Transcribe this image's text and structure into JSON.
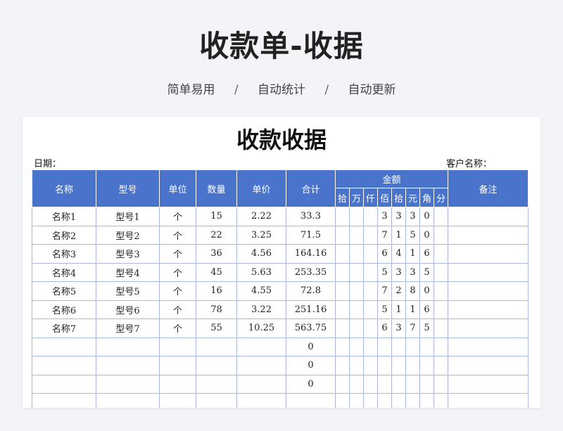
{
  "banner": {
    "title": "收款单-收据",
    "tags": [
      "简单易用",
      "自动统计",
      "自动更新"
    ],
    "separator": "/"
  },
  "sheet": {
    "title": "收款收据",
    "date_label": "日期：",
    "client_label": "客户名称："
  },
  "table": {
    "headers": {
      "name": "名称",
      "model": "型号",
      "unit": "单位",
      "qty": "数量",
      "price": "单价",
      "total": "合计",
      "amount": "金额",
      "remark": "备注"
    },
    "digit_headers": [
      "拾",
      "万",
      "仟",
      "佰",
      "拾",
      "元",
      "角",
      "分"
    ],
    "rows": [
      {
        "name": "名称1",
        "model": "型号1",
        "unit": "个",
        "qty": "15",
        "price": "2.22",
        "total": "33.3",
        "digits": [
          "",
          "",
          "",
          "3",
          "3",
          "3",
          "0",
          ""
        ],
        "remark": ""
      },
      {
        "name": "名称2",
        "model": "型号2",
        "unit": "个",
        "qty": "22",
        "price": "3.25",
        "total": "71.5",
        "digits": [
          "",
          "",
          "",
          "7",
          "1",
          "5",
          "0",
          ""
        ],
        "remark": ""
      },
      {
        "name": "名称3",
        "model": "型号3",
        "unit": "个",
        "qty": "36",
        "price": "4.56",
        "total": "164.16",
        "digits": [
          "",
          "",
          "",
          "6",
          "4",
          "1",
          "6",
          ""
        ],
        "remark": ""
      },
      {
        "name": "名称4",
        "model": "型号4",
        "unit": "个",
        "qty": "45",
        "price": "5.63",
        "total": "253.35",
        "digits": [
          "",
          "",
          "",
          "5",
          "3",
          "3",
          "5",
          ""
        ],
        "remark": ""
      },
      {
        "name": "名称5",
        "model": "型号5",
        "unit": "个",
        "qty": "16",
        "price": "4.55",
        "total": "72.8",
        "digits": [
          "",
          "",
          "",
          "7",
          "2",
          "8",
          "0",
          ""
        ],
        "remark": ""
      },
      {
        "name": "名称6",
        "model": "型号6",
        "unit": "个",
        "qty": "78",
        "price": "3.22",
        "total": "251.16",
        "digits": [
          "",
          "",
          "",
          "5",
          "1",
          "1",
          "6",
          ""
        ],
        "remark": ""
      },
      {
        "name": "名称7",
        "model": "型号7",
        "unit": "个",
        "qty": "55",
        "price": "10.25",
        "total": "563.75",
        "digits": [
          "",
          "",
          "",
          "6",
          "3",
          "7",
          "5",
          ""
        ],
        "remark": ""
      },
      {
        "name": "",
        "model": "",
        "unit": "",
        "qty": "",
        "price": "",
        "total": "0",
        "digits": [
          "",
          "",
          "",
          "",
          "",
          "",
          "",
          ""
        ],
        "remark": ""
      },
      {
        "name": "",
        "model": "",
        "unit": "",
        "qty": "",
        "price": "",
        "total": "0",
        "digits": [
          "",
          "",
          "",
          "",
          "",
          "",
          "",
          ""
        ],
        "remark": ""
      },
      {
        "name": "",
        "model": "",
        "unit": "",
        "qty": "",
        "price": "",
        "total": "0",
        "digits": [
          "",
          "",
          "",
          "",
          "",
          "",
          "",
          ""
        ],
        "remark": ""
      },
      {
        "name": "",
        "model": "",
        "unit": "",
        "qty": "",
        "price": "",
        "total": "",
        "digits": [
          "",
          "",
          "",
          "",
          "",
          "",
          "",
          ""
        ],
        "remark": ""
      }
    ]
  },
  "colors": {
    "header_bg": "#4a74cc",
    "grid_line": "#a9b8de",
    "page_bg": "#f2f4f8"
  }
}
